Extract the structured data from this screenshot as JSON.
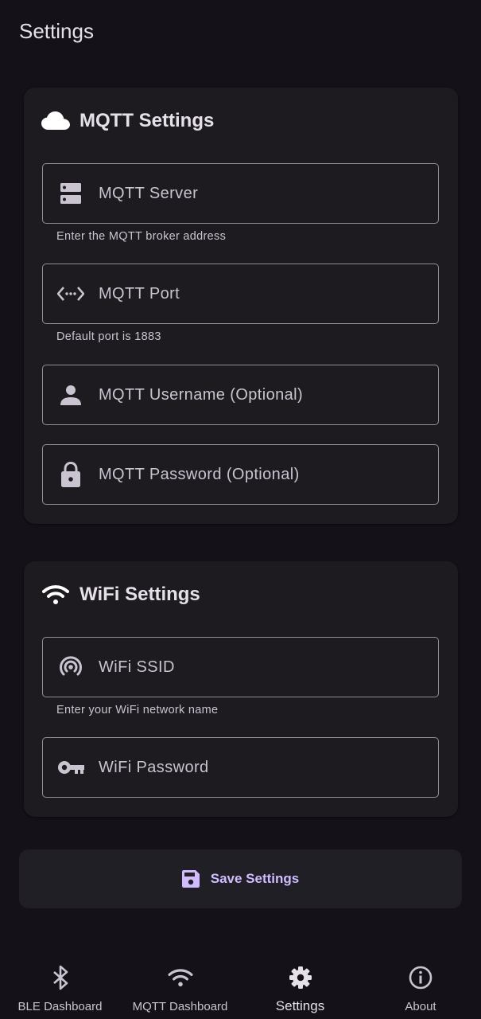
{
  "app_bar": {
    "title": "Settings"
  },
  "mqtt_card": {
    "title": "MQTT Settings",
    "header_icon": "cloud-icon",
    "fields": [
      {
        "label": "MQTT Server",
        "icon": "server-icon",
        "helper": "Enter the MQTT broker address"
      },
      {
        "label": "MQTT Port",
        "icon": "code-arrows-icon",
        "helper": "Default port is 1883"
      },
      {
        "label": "MQTT Username (Optional)",
        "icon": "person-icon"
      },
      {
        "label": "MQTT Password (Optional)",
        "icon": "lock-icon"
      }
    ]
  },
  "wifi_card": {
    "title": "WiFi Settings",
    "header_icon": "wifi-icon",
    "fields": [
      {
        "label": "WiFi SSID",
        "icon": "signal-icon",
        "helper": "Enter your WiFi network name"
      },
      {
        "label": "WiFi Password",
        "icon": "key-icon"
      }
    ]
  },
  "save_button": {
    "label": "Save Settings",
    "icon": "save-icon"
  },
  "bottom_nav": {
    "items": [
      {
        "label": "BLE Dashboard",
        "icon": "bluetooth-icon",
        "active": false
      },
      {
        "label": "MQTT Dashboard",
        "icon": "wifi-icon",
        "active": false
      },
      {
        "label": "Settings",
        "icon": "gear-icon",
        "active": true
      },
      {
        "label": "About",
        "icon": "info-icon",
        "active": false
      }
    ]
  },
  "colors": {
    "background": "#141218",
    "card": "#1d1b20",
    "outline": "#938f99",
    "text": "#e6e0e9",
    "muted_text": "#cac4d0",
    "accent": "#d0bcff"
  }
}
